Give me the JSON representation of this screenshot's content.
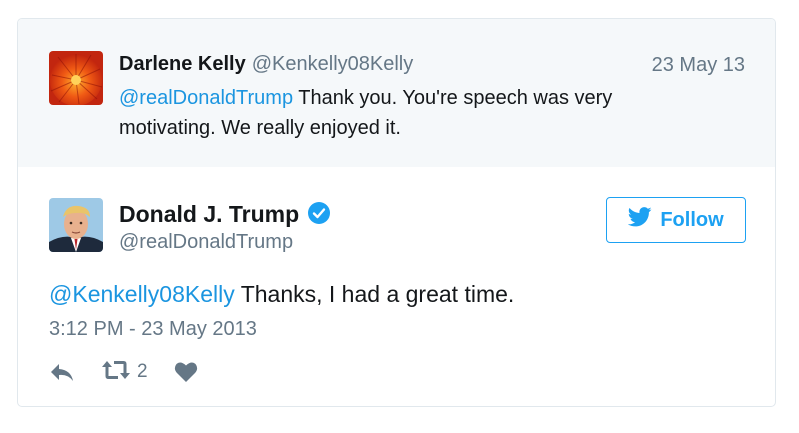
{
  "parent_tweet": {
    "name": "Darlene Kelly",
    "handle": "@Kenkelly08Kelly",
    "date": "23 May 13",
    "mention": "@realDonaldTrump",
    "text": " Thank you. You're speech was very motivating. We really enjoyed it.",
    "avatar_icon": "orange-flower-avatar"
  },
  "main_tweet": {
    "name": "Donald J. Trump",
    "verified_icon": "verified-badge-icon",
    "handle": "@realDonaldTrump",
    "follow_label": "Follow",
    "mention": "@Kenkelly08Kelly",
    "text": " Thanks, I had a great time.",
    "timestamp": "3:12 PM - 23 May 2013",
    "avatar_icon": "profile-photo-avatar"
  },
  "actions": {
    "reply_icon": "reply-icon",
    "retweet_icon": "retweet-icon",
    "retweet_count": "2",
    "like_icon": "heart-icon"
  },
  "colors": {
    "accent": "#1da1f2",
    "mention": "#1b95e0",
    "muted": "#657786",
    "parent_bg": "#f5f8fa"
  }
}
